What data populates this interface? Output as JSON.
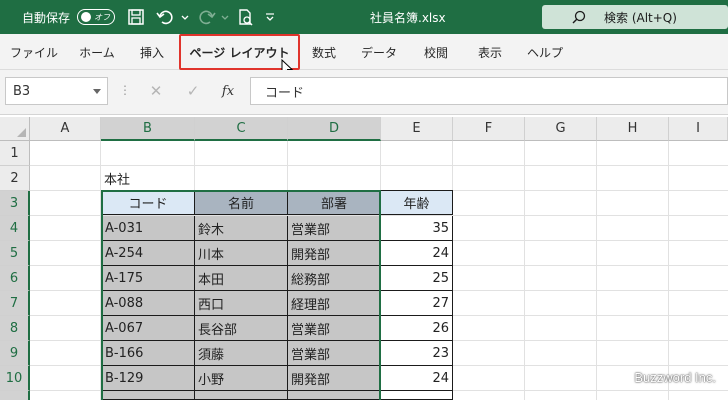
{
  "titlebar": {
    "autosave_label": "自動保存",
    "autosave_state": "オフ",
    "filename": "社員名簿.xlsx",
    "search_placeholder": "検索 (Alt+Q)"
  },
  "ribbon": {
    "tabs": [
      "ファイル",
      "ホーム",
      "挿入",
      "ページ レイアウト",
      "数式",
      "データ",
      "校閲",
      "表示",
      "ヘルプ"
    ],
    "highlighted_tab": "ページ レイアウト"
  },
  "formula_bar": {
    "name_box": "B3",
    "fx_label": "fx",
    "content": "コード"
  },
  "grid": {
    "columns": [
      "A",
      "B",
      "C",
      "D",
      "E",
      "F",
      "G",
      "H",
      "I"
    ],
    "rows": [
      "1",
      "2",
      "3",
      "4",
      "5",
      "6",
      "7",
      "8",
      "9",
      "10"
    ],
    "b2": "本社",
    "table_headers": [
      "コード",
      "名前",
      "部署",
      "年齢"
    ],
    "table_rows": [
      [
        "A-031",
        "鈴木",
        "営業部",
        "35"
      ],
      [
        "A-254",
        "川本",
        "開発部",
        "24"
      ],
      [
        "A-175",
        "本田",
        "総務部",
        "25"
      ],
      [
        "A-088",
        "西口",
        "経理部",
        "27"
      ],
      [
        "A-067",
        "長谷部",
        "営業部",
        "26"
      ],
      [
        "B-166",
        "須藤",
        "営業部",
        "23"
      ],
      [
        "B-129",
        "小野",
        "開発部",
        "24"
      ]
    ],
    "selected_cell": "B3"
  },
  "watermark": "Buzzword Inc.",
  "colors": {
    "title_bar": "#1f6e43",
    "highlight_border": "#e0342c",
    "table_header": "#dbe8f5",
    "selection": "#c6c6c6"
  }
}
